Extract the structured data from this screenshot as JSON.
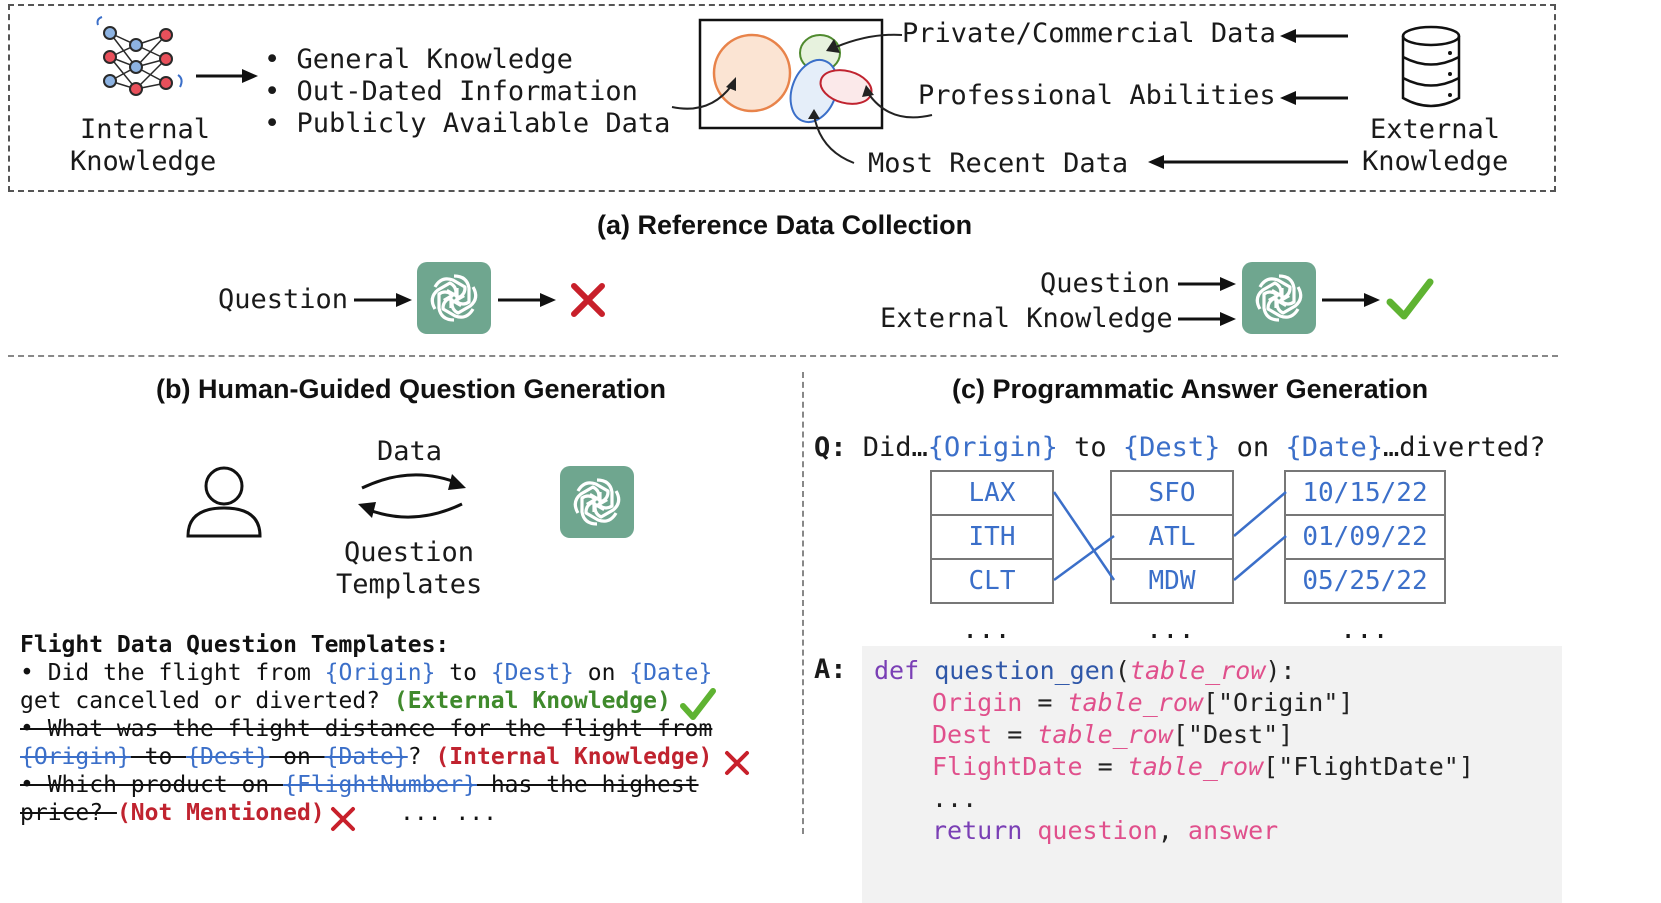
{
  "panel_a": {
    "internal_label_1": "Internal",
    "internal_label_2": "Knowledge",
    "bullets": [
      "General Knowledge",
      "Out-Dated Information",
      "Publicly Available Data"
    ],
    "right_items": [
      "Private/Commercial Data",
      "Professional Abilities",
      "Most Recent Data"
    ],
    "external_label_1": "External",
    "external_label_2": "Knowledge",
    "caption": "(a) Reference Data Collection",
    "left_flow_question": "Question",
    "right_flow_question": "Question",
    "right_flow_external": "External Knowledge"
  },
  "panel_b": {
    "title": "(b) Human-Guided Question Generation",
    "data_label": "Data",
    "question_label": "Question",
    "templates_label": "Templates",
    "templates_heading": "Flight Data Question Templates:",
    "t1_line1_a": "• Did the flight from ",
    "t1_origin": "{Origin}",
    "t1_to": " to ",
    "t1_dest": "{Dest}",
    "t1_on": " on ",
    "t1_date": "{Date}",
    "t1_line2": "get cancelled or diverted? ",
    "t1_tag": "(External Knowledge)",
    "t2_line1": "• What was the flight distance for the flight from",
    "t2_origin": "{Origin}",
    "t2_to": " to ",
    "t2_dest": "{Dest}",
    "t2_on": " on ",
    "t2_date": "{Date}",
    "t2_q": "? ",
    "t2_tag": "(Internal Knowledge)",
    "t3_line1_a": "• Which product on ",
    "t3_flight": "{FlightNumber}",
    "t3_line1_b": " has the highest",
    "t3_line2": "price? ",
    "t3_tag": "(Not Mentioned)",
    "t3_ellipsis": "... ..."
  },
  "panel_c": {
    "title": "(c) Programmatic Answer Generation",
    "q_prefix": "Q:",
    "q_did": " Did…",
    "q_origin": "{Origin}",
    "q_to": " to ",
    "q_dest": "{Dest}",
    "q_on": " on ",
    "q_date": "{Date}",
    "q_end": "…diverted?",
    "origin_col": [
      "LAX",
      "ITH",
      "CLT"
    ],
    "dest_col": [
      "SFO",
      "ATL",
      "MDW"
    ],
    "date_col": [
      "10/15/22",
      "01/09/22",
      "05/25/22"
    ],
    "col_ellipsis": "...",
    "a_prefix": "A:",
    "code": {
      "def": "def",
      "fname": "question_gen",
      "param": "table_row",
      "l2_var": "Origin",
      "l2_key": "\"Origin\"",
      "l3_var": "Dest",
      "l3_key": "\"Dest\"",
      "l4_var": "FlightDate",
      "l4_key": "\"FlightDate\"",
      "l5": "...",
      "ret": "return",
      "r1": "question",
      "r2": "answer"
    }
  },
  "colors": {
    "gpt_bg": "#6fa68f",
    "check_green": "#5fb332",
    "cross_red": "#c8202b",
    "link_blue": "#3b6fc9"
  }
}
